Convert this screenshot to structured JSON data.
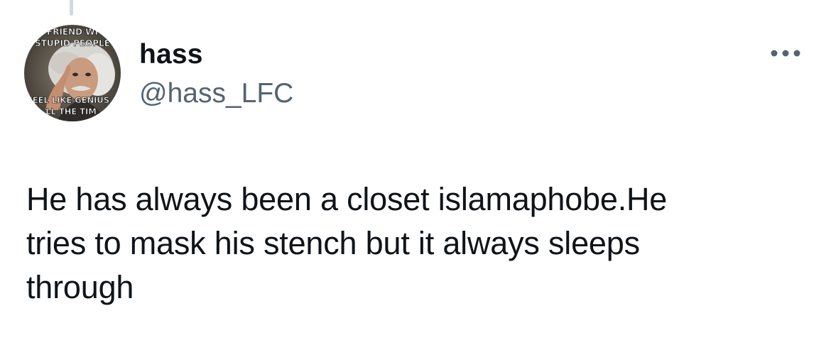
{
  "colors": {
    "primary_text": "#0f1419",
    "secondary_text": "#536471",
    "thread_line": "#cfd9de",
    "background": "#ffffff"
  },
  "author": {
    "display_name": "hass",
    "handle": "@hass_LFC",
    "avatar_meme_text": {
      "top": "FRIEND WI",
      "top2": "STUPID PEOPLE",
      "bottom": "FEEL LIKE GENIUS",
      "bottom2": "LL THE TIM"
    }
  },
  "actions": {
    "more_icon": "more-horizontal-icon"
  },
  "tweet": {
    "text": "He has always been a closet islamaphobe.He\ntries to mask his stench but it always sleeps\nthrough"
  }
}
